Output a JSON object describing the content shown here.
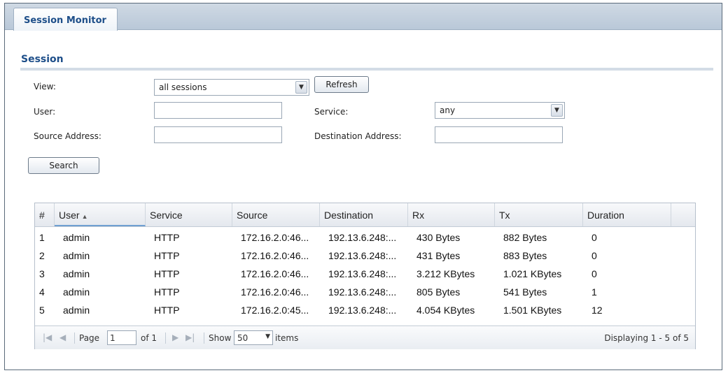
{
  "tab": {
    "label": "Session Monitor"
  },
  "section": {
    "title": "Session"
  },
  "form": {
    "view_label": "View:",
    "view_value": "all sessions",
    "refresh_label": "Refresh",
    "user_label": "User:",
    "user_value": "",
    "service_label": "Service:",
    "service_value": "any",
    "source_label": "Source Address:",
    "source_value": "",
    "destination_label": "Destination Address:",
    "destination_value": "",
    "search_label": "Search"
  },
  "table": {
    "columns": [
      "#",
      "User",
      "Service",
      "Source",
      "Destination",
      "Rx",
      "Tx",
      "Duration"
    ],
    "sorted_column": "User",
    "sort_direction": "ascending",
    "rows": [
      [
        "1",
        "admin",
        "HTTP",
        "172.16.2.0:46...",
        "192.13.6.248:...",
        "430 Bytes",
        "882 Bytes",
        "0"
      ],
      [
        "2",
        "admin",
        "HTTP",
        "172.16.2.0:46...",
        "192.13.6.248:...",
        "431 Bytes",
        "883 Bytes",
        "0"
      ],
      [
        "3",
        "admin",
        "HTTP",
        "172.16.2.0:46...",
        "192.13.6.248:...",
        "3.212 KBytes",
        "1.021 KBytes",
        "0"
      ],
      [
        "4",
        "admin",
        "HTTP",
        "172.16.2.0:46...",
        "192.13.6.248:...",
        "805 Bytes",
        "541 Bytes",
        "1"
      ],
      [
        "5",
        "admin",
        "HTTP",
        "172.16.2.0:45...",
        "192.13.6.248:...",
        "4.054 KBytes",
        "1.501 KBytes",
        "12"
      ]
    ]
  },
  "pager": {
    "page_label": "Page",
    "page_value": "1",
    "of_label": "of 1",
    "show_label": "Show",
    "show_value": "50",
    "items_label": "items",
    "displaying": "Displaying 1 - 5 of 5"
  },
  "icons": {
    "first": "first-page-icon",
    "prev": "previous-page-icon",
    "next": "next-page-icon",
    "last": "last-page-icon",
    "dropdown": "chevron-down-icon",
    "sort": "sort-ascending-icon"
  },
  "colors": {
    "accent": "#1d4e89",
    "tab_bar": "#b9c8d8",
    "sorted_underline": "#6f9fd1"
  }
}
